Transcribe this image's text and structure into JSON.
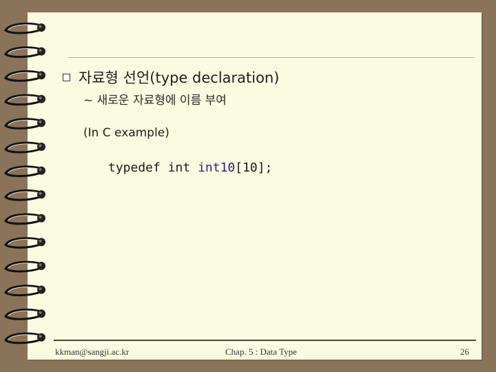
{
  "slide": {
    "heading": "자료형 선언(type declaration)",
    "subtext": "~ 새로운 자료형에 이름 부여",
    "example_label": "(In C example)",
    "code": {
      "keyword1": "typedef",
      "keyword2": "int",
      "type_name": "int10",
      "rest": "[10];"
    }
  },
  "footer": {
    "email": "kkman@sangji.ac.kr",
    "chapter": "Chap. 5 : Data Type",
    "page_number": "26"
  },
  "colors": {
    "background": "#8a735a",
    "page": "#fbfbe1",
    "type_name": "#3a1a7a"
  }
}
